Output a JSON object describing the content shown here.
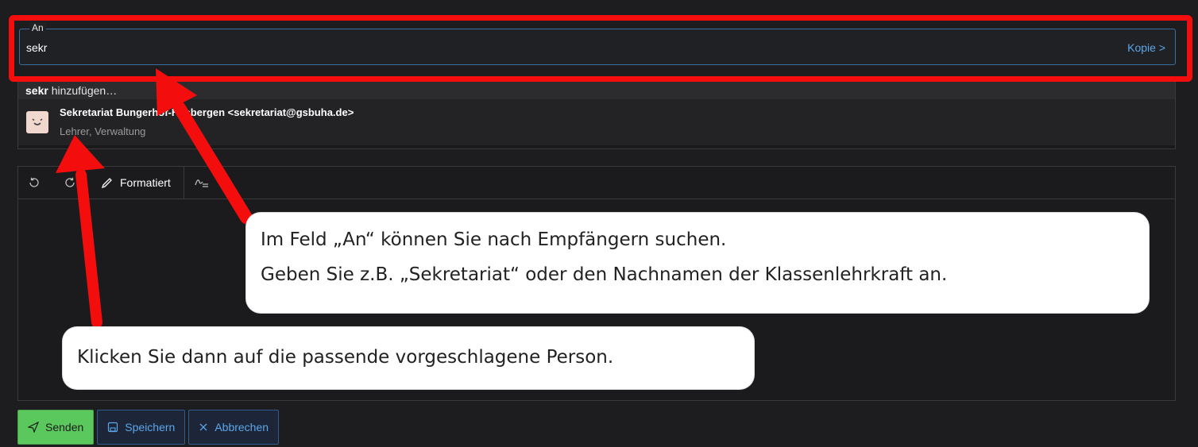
{
  "to_field": {
    "label": "An",
    "value": "sekr",
    "copy_link": "Kopie >"
  },
  "suggestions": {
    "add_query": "sekr",
    "add_suffix": " hinzufügen…",
    "contact": {
      "name": "Sekretariat Bungerhof-Hasbergen <sekretariat@gsbuha.de>",
      "groups": "Lehrer, Verwaltung",
      "avatar_icon": "smiley-face-icon"
    }
  },
  "toolbar": {
    "undo_icon": "undo-icon",
    "redo_icon": "redo-icon",
    "format_label": "Formatiert",
    "signature_icon": "signature-icon"
  },
  "footer": {
    "send_label": "Senden",
    "save_label": "Speichern",
    "cancel_label": "Abbrechen"
  },
  "callouts": {
    "line1": "Im Feld „An“ können Sie nach Empfängern suchen.",
    "line2": "Geben Sie z.B. „Sekretariat“ oder den Nachnamen der Klassenlehrkraft an.",
    "line3": "Klicken Sie dann auf die passende vorgeschlagene Person."
  },
  "colors": {
    "highlight": "#f40d0d",
    "accent": "#5ba7ea",
    "send": "#5bc85d"
  }
}
